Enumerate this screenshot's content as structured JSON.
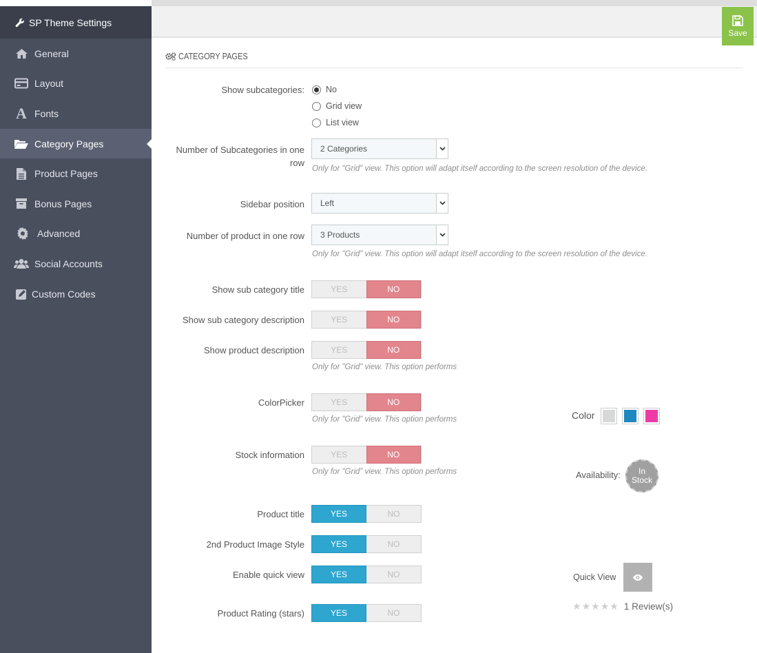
{
  "sidebar": {
    "title": "SP Theme Settings",
    "items": [
      {
        "label": "General",
        "icon": "home-icon"
      },
      {
        "label": "Layout",
        "icon": "credit-card-icon"
      },
      {
        "label": "Fonts",
        "icon": "font-icon"
      },
      {
        "label": "Category Pages",
        "icon": "folder-open-icon",
        "active": true
      },
      {
        "label": "Product Pages",
        "icon": "file-icon"
      },
      {
        "label": "Bonus Pages",
        "icon": "archive-icon"
      },
      {
        "label": "Advanced",
        "icon": "gear-icon"
      },
      {
        "label": "Social Accounts",
        "icon": "users-icon"
      },
      {
        "label": "Custom Codes",
        "icon": "edit-icon"
      }
    ]
  },
  "toolbar": {
    "save_label": "Save"
  },
  "section": {
    "title": "CATEGORY PAGES"
  },
  "form": {
    "show_subcategories": {
      "label": "Show subcategories:",
      "options": [
        "No",
        "Grid view",
        "List view"
      ],
      "selected": "No"
    },
    "subcategories_per_row": {
      "label_line1": "Number of Subcategories in one",
      "label_line2": "row",
      "value": "2 Categories",
      "help": "Only for \"Grid\" view. This option will adapt itself according to the screen resolution of the device."
    },
    "sidebar_position": {
      "label": "Sidebar position",
      "value": "Left"
    },
    "products_per_row": {
      "label": "Number of product in one row",
      "value": "3 Products",
      "help": "Only for \"Grid\" view. This option will adapt itself according to the screen resolution of the device."
    },
    "yes_label": "YES",
    "no_label": "NO",
    "show_sub_category_title": {
      "label": "Show sub category title",
      "value": false
    },
    "show_sub_category_description": {
      "label": "Show sub category description",
      "value": false
    },
    "show_product_description": {
      "label": "Show product description",
      "value": false,
      "help": "Only for \"Grid\" view. This option performs"
    },
    "color_picker": {
      "label": "ColorPicker",
      "value": false,
      "help": "Only for \"Grid\" view. This option performs"
    },
    "stock_information": {
      "label": "Stock information",
      "value": false,
      "help": "Only for \"Grid\" view. This option performs"
    },
    "product_title": {
      "label": "Product title",
      "value": true
    },
    "second_image_style": {
      "label": "2nd Product Image Style",
      "value": true
    },
    "enable_quick_view": {
      "label": "Enable quick view",
      "value": true
    },
    "product_rating": {
      "label": "Product Rating (stars)",
      "value": true
    }
  },
  "preview": {
    "color_label": "Color",
    "swatches": [
      "#d7d9d8",
      "#1f88be",
      "#ee3aa7"
    ],
    "availability_label": "Availability:",
    "stock_line1": "In",
    "stock_line2": "Stock",
    "quick_view_label": "Quick View",
    "reviews": "1 Review(s)"
  },
  "colors": {
    "sidebar_bg": "#4a4f5e",
    "sidebar_header_bg": "#3a3f4b",
    "active_item_bg": "#5b6172",
    "save_green": "#8bc34a",
    "yes_blue": "#2ea6cf",
    "no_red": "#e2858c"
  }
}
